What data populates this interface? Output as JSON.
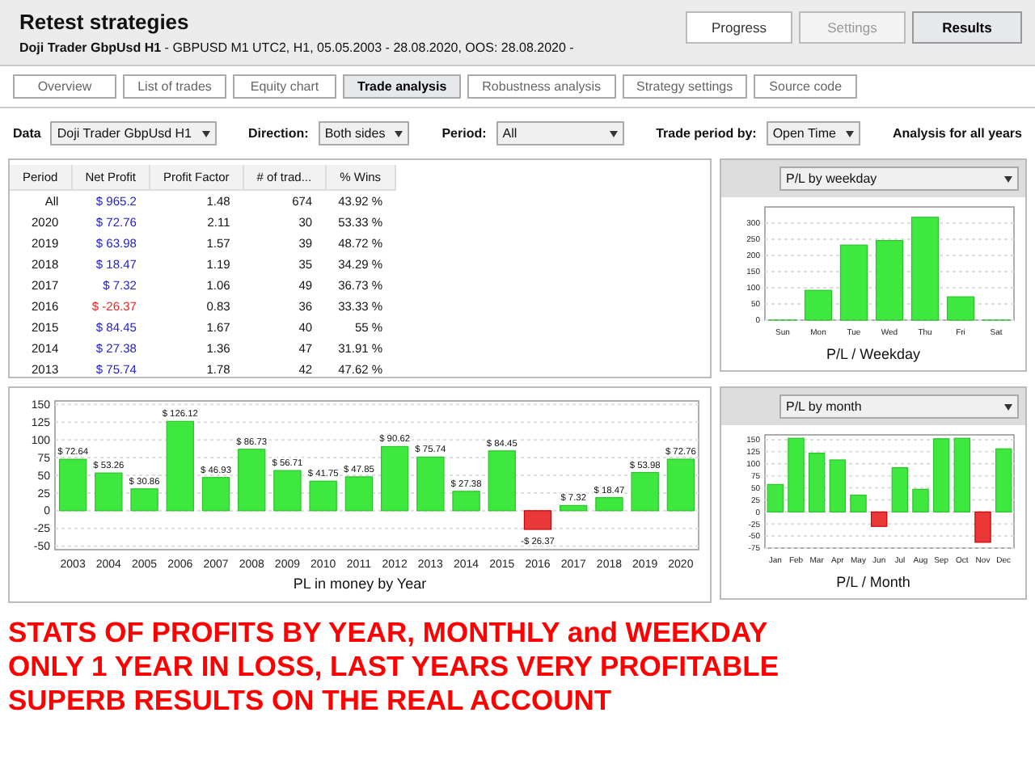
{
  "header": {
    "title": "Retest strategies",
    "subtitle": "**Doji Trader GbpUsd H1** - GBPUSD  M1  UTC2, H1, 05.05.2003 - 28.08.2020, OOS: 28.08.2020 -",
    "buttons": [
      {
        "label": "Progress",
        "selected": false,
        "disabled": false
      },
      {
        "label": "Settings",
        "selected": false,
        "disabled": true
      },
      {
        "label": "Results",
        "selected": true,
        "disabled": false
      }
    ]
  },
  "tabs": [
    {
      "label": "Overview",
      "selected": false
    },
    {
      "label": "List of trades",
      "selected": false
    },
    {
      "label": "Equity chart",
      "selected": false
    },
    {
      "label": "Trade analysis",
      "selected": true
    },
    {
      "label": "Robustness analysis",
      "selected": false
    },
    {
      "label": "Strategy settings",
      "selected": false
    },
    {
      "label": "Source code",
      "selected": false
    }
  ],
  "filters": [
    {
      "label": "Data",
      "value": "Doji Trader GbpUsd H1"
    },
    {
      "label": "Direction:",
      "value": "Both sides"
    },
    {
      "label": "Period:",
      "value": "All"
    },
    {
      "label": "Trade period by:",
      "value": "Open Time"
    }
  ],
  "analysis_note": "Analysis for all years",
  "table": {
    "columns": [
      "Period",
      "Net Profit",
      "Profit Factor",
      "# of trad...",
      "% Wins"
    ],
    "rows": [
      {
        "period": "All",
        "net_profit": "$ 965.2",
        "loss": false,
        "profit_factor": "1.48",
        "trades": "674",
        "wins": "43.92 %"
      },
      {
        "period": "2020",
        "net_profit": "$ 72.76",
        "loss": false,
        "profit_factor": "2.11",
        "trades": "30",
        "wins": "53.33 %"
      },
      {
        "period": "2019",
        "net_profit": "$ 63.98",
        "loss": false,
        "profit_factor": "1.57",
        "trades": "39",
        "wins": "48.72 %"
      },
      {
        "period": "2018",
        "net_profit": "$ 18.47",
        "loss": false,
        "profit_factor": "1.19",
        "trades": "35",
        "wins": "34.29 %"
      },
      {
        "period": "2017",
        "net_profit": "$ 7.32",
        "loss": false,
        "profit_factor": "1.06",
        "trades": "49",
        "wins": "36.73 %"
      },
      {
        "period": "2016",
        "net_profit": "$ -26.37",
        "loss": true,
        "profit_factor": "0.83",
        "trades": "36",
        "wins": "33.33 %"
      },
      {
        "period": "2015",
        "net_profit": "$ 84.45",
        "loss": false,
        "profit_factor": "1.67",
        "trades": "40",
        "wins": "55 %"
      },
      {
        "period": "2014",
        "net_profit": "$ 27.38",
        "loss": false,
        "profit_factor": "1.36",
        "trades": "47",
        "wins": "31.91 %"
      },
      {
        "period": "2013",
        "net_profit": "$ 75.74",
        "loss": false,
        "profit_factor": "1.78",
        "trades": "42",
        "wins": "47.62 %"
      }
    ]
  },
  "weekday_panel": {
    "dropdown": "P/L by weekday",
    "chart_data": {
      "type": "bar",
      "xlabel": "P/L / Weekday",
      "categories": [
        "Sun",
        "Mon",
        "Tue",
        "Wed",
        "Thu",
        "Fri",
        "Sat"
      ],
      "values": [
        0,
        92,
        232,
        246,
        318,
        72,
        0
      ],
      "ylim": [
        0,
        350
      ],
      "yticks": [
        0,
        50,
        100,
        150,
        200,
        250,
        300
      ],
      "grid": true
    }
  },
  "year_panel": {
    "chart_data": {
      "type": "bar",
      "xlabel": "PL in money by Year",
      "categories": [
        "2003",
        "2004",
        "2005",
        "2006",
        "2007",
        "2008",
        "2009",
        "2010",
        "2011",
        "2012",
        "2013",
        "2014",
        "2015",
        "2016",
        "2017",
        "2018",
        "2019",
        "2020"
      ],
      "values": [
        72.64,
        53.26,
        30.86,
        126.12,
        46.93,
        86.73,
        56.71,
        41.75,
        47.85,
        90.62,
        75.74,
        27.38,
        84.45,
        -26.37,
        7.32,
        18.47,
        53.98,
        72.76
      ],
      "ylim": [
        -55,
        155
      ],
      "yticks": [
        -50,
        -25,
        0,
        25,
        50,
        75,
        100,
        125,
        150
      ],
      "grid": true,
      "value_labels": [
        "$ 72.64",
        "$ 53.26",
        "$ 30.86",
        "$ 126.12",
        "$ 46.93",
        "$ 86.73",
        "$ 56.71",
        "$ 41.75",
        "$ 47.85",
        "$ 90.62",
        "$ 75.74",
        "$ 27.38",
        "$ 84.45",
        "-$ 26.37",
        "$ 7.32",
        "$ 18.47",
        "$ 53.98",
        "$ 72.76"
      ]
    }
  },
  "month_panel": {
    "dropdown": "P/L by month",
    "chart_data": {
      "type": "bar",
      "xlabel": "P/L / Month",
      "categories": [
        "Jan",
        "Feb",
        "Mar",
        "Apr",
        "May",
        "Jun",
        "Jul",
        "Aug",
        "Sep",
        "Oct",
        "Nov",
        "Dec"
      ],
      "values": [
        57,
        153,
        122,
        108,
        35,
        -30,
        92,
        47,
        152,
        153,
        -63,
        131
      ],
      "ylim": [
        -75,
        160
      ],
      "yticks": [
        -75,
        -50,
        -25,
        0,
        25,
        50,
        75,
        100,
        125,
        150
      ],
      "grid": true
    }
  },
  "banner": [
    "STATS OF PROFITS BY YEAR, MONTHLY and WEEKDAY",
    "ONLY 1 YEAR IN LOSS, LAST YEARS VERY PROFITABLE",
    "SUPERB RESULTS ON THE REAL ACCOUNT"
  ]
}
